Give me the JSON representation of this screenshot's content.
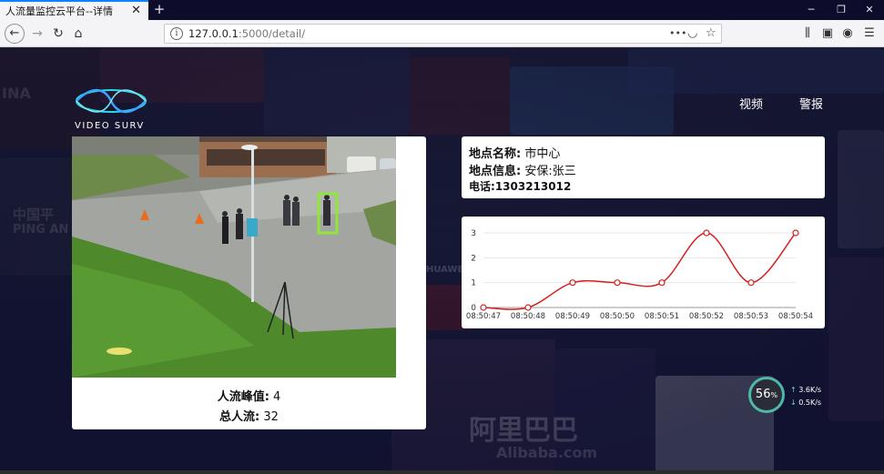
{
  "browser": {
    "tab_title": "人流量监控云平台--详情",
    "url_host": "127.0.0.1",
    "url_rest": ":5000/detail/",
    "url_more": "•••"
  },
  "header": {
    "logo_text": "VIDEO SURV",
    "nav": [
      {
        "label": "视频"
      },
      {
        "label": "警报"
      }
    ]
  },
  "stats": {
    "peak_label": "人流峰值:",
    "peak_value": "4",
    "total_label": "总人流:",
    "total_value": "32"
  },
  "location": {
    "name_label": "地点名称:",
    "name_value": "市中心",
    "info_label": "地点信息:",
    "info_value": "安保:张三",
    "phone_label": "电话:",
    "phone_value": "1303213012"
  },
  "chart_data": {
    "type": "line",
    "x": [
      "08:50:47",
      "08:50:48",
      "08:50:49",
      "08:50:50",
      "08:50:51",
      "08:50:52",
      "08:50:53",
      "08:50:54"
    ],
    "y": [
      0,
      0,
      1,
      1,
      1,
      3,
      1,
      3
    ],
    "ylim": [
      0,
      3
    ],
    "yticks": [
      0,
      1,
      2,
      3
    ],
    "smooth": true,
    "grid": true,
    "color": "#d42020"
  },
  "network_widget": {
    "percent": "56",
    "percent_unit": "%",
    "upload": "3.6",
    "upload_unit": "K/s",
    "download": "0.5",
    "download_unit": "K/s"
  },
  "colors": {
    "accent": "#0a84ff",
    "chart_line": "#d42020",
    "bbox": "#8ee63a"
  }
}
